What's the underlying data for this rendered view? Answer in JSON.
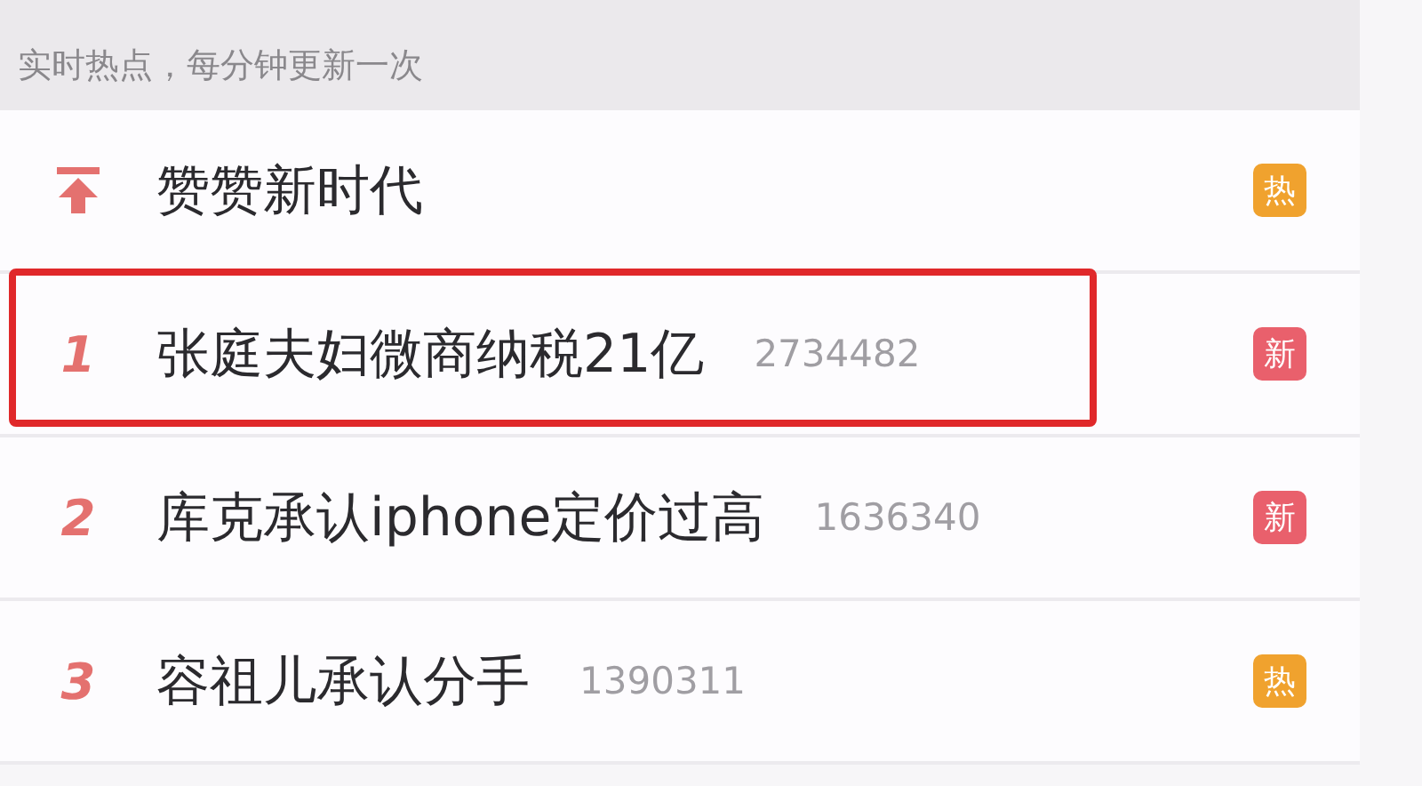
{
  "header": {
    "text": "实时热点，每分钟更新一次"
  },
  "rows": [
    {
      "kind": "pinned",
      "title": "赞赞新时代",
      "badge": {
        "text": "热",
        "color": "#f0a22e"
      },
      "highlighted": false
    },
    {
      "kind": "ranked",
      "rank": "1",
      "title": "张庭夫妇微商纳税21亿",
      "count": "2734482",
      "badge": {
        "text": "新",
        "color": "#e9606c"
      },
      "highlighted": true
    },
    {
      "kind": "ranked",
      "rank": "2",
      "title": "库克承认iphone定价过高",
      "count": "1636340",
      "badge": {
        "text": "新",
        "color": "#e9606c"
      },
      "highlighted": false
    },
    {
      "kind": "ranked",
      "rank": "3",
      "title": "容祖儿承认分手",
      "count": "1390311",
      "badge": {
        "text": "热",
        "color": "#f0a22e"
      },
      "highlighted": false
    }
  ]
}
